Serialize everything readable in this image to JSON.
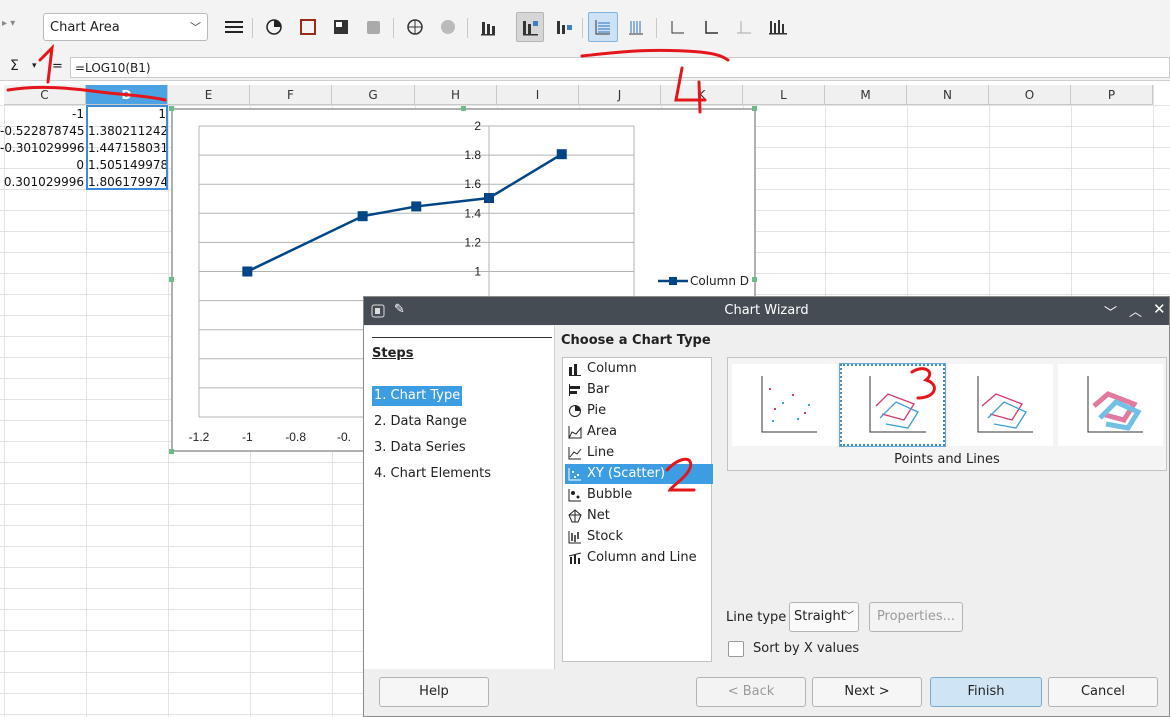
{
  "toolbar": {
    "element_select_value": "Chart Area"
  },
  "formula_bar": {
    "formula": "=LOG10(B1)"
  },
  "sheet": {
    "columns": [
      "C",
      "D",
      "E",
      "F",
      "G",
      "H",
      "I",
      "J",
      "K",
      "L",
      "M",
      "N",
      "O",
      "P"
    ],
    "selected_column": "D",
    "rows": [
      {
        "c": "-1",
        "d": "1"
      },
      {
        "c": "-0.522878745",
        "d": "1.380211242"
      },
      {
        "c": "-0.301029996",
        "d": "1.447158031"
      },
      {
        "c": "0",
        "d": "1.505149978"
      },
      {
        "c": "0.301029996",
        "d": "1.806179974"
      }
    ]
  },
  "chart": {
    "legend": "Column D",
    "y_ticks": [
      "2",
      "1.8",
      "1.6",
      "1.4",
      "1.2",
      "1"
    ],
    "x_ticks": [
      "-1.2",
      "-1",
      "-0.8",
      "-0."
    ]
  },
  "chart_data": {
    "type": "line",
    "series": [
      {
        "name": "Column D",
        "x": [
          -1,
          -0.522878745,
          -0.301029996,
          0,
          0.301029996
        ],
        "values": [
          1,
          1.380211242,
          1.447158031,
          1.505149978,
          1.806179974
        ]
      }
    ],
    "ylim": [
      0,
      2
    ],
    "xlim": [
      -1.2,
      0.6
    ],
    "grid": true,
    "legend_position": "right"
  },
  "dialog": {
    "title": "Chart Wizard",
    "steps_heading": "Steps",
    "steps": [
      "1. Chart Type",
      "2. Data Range",
      "3. Data Series",
      "4. Chart Elements"
    ],
    "choose_heading": "Choose a Chart Type",
    "chart_types": [
      "Column",
      "Bar",
      "Pie",
      "Area",
      "Line",
      "XY (Scatter)",
      "Bubble",
      "Net",
      "Stock",
      "Column and Line"
    ],
    "selected_type": "XY (Scatter)",
    "variant_caption": "Points and Lines",
    "line_type_label": "Line type",
    "line_type_value": "Straight",
    "properties_label": "Properties...",
    "sort_label": "Sort by X values",
    "buttons": {
      "help": "Help",
      "back": "< Back",
      "next": "Next >",
      "finish": "Finish",
      "cancel": "Cancel"
    }
  },
  "annotations": [
    "1",
    "2",
    "3",
    "4"
  ],
  "colors": {
    "selection": "#3d9de3",
    "series": "#004586",
    "annotation": "#e4161b",
    "titlebar": "#454c54"
  }
}
